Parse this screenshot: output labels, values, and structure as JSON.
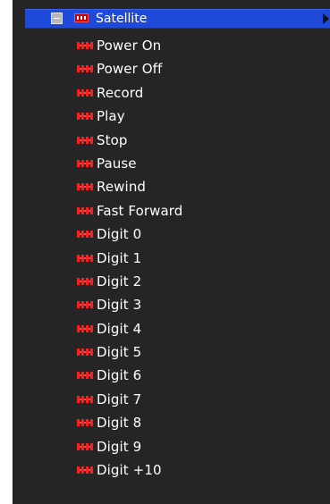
{
  "tree": {
    "parent": {
      "label": "Satellite",
      "selected_color": "#1f49d8",
      "icon": "device-icon",
      "collapse_icon": "collapse-icon",
      "arrow_icon": "chevron-right-icon"
    },
    "items": [
      {
        "label": "Power On",
        "icon": "command-icon"
      },
      {
        "label": "Power Off",
        "icon": "command-icon"
      },
      {
        "label": "Record",
        "icon": "command-icon"
      },
      {
        "label": "Play",
        "icon": "command-icon"
      },
      {
        "label": "Stop",
        "icon": "command-icon"
      },
      {
        "label": "Pause",
        "icon": "command-icon"
      },
      {
        "label": "Rewind",
        "icon": "command-icon"
      },
      {
        "label": "Fast Forward",
        "icon": "command-icon"
      },
      {
        "label": "Digit 0",
        "icon": "command-icon"
      },
      {
        "label": "Digit 1",
        "icon": "command-icon"
      },
      {
        "label": "Digit 2",
        "icon": "command-icon"
      },
      {
        "label": "Digit 3",
        "icon": "command-icon"
      },
      {
        "label": "Digit 4",
        "icon": "command-icon"
      },
      {
        "label": "Digit 5",
        "icon": "command-icon"
      },
      {
        "label": "Digit 6",
        "icon": "command-icon"
      },
      {
        "label": "Digit 7",
        "icon": "command-icon"
      },
      {
        "label": "Digit 8",
        "icon": "command-icon"
      },
      {
        "label": "Digit 9",
        "icon": "command-icon"
      },
      {
        "label": "Digit +10",
        "icon": "command-icon"
      }
    ]
  }
}
